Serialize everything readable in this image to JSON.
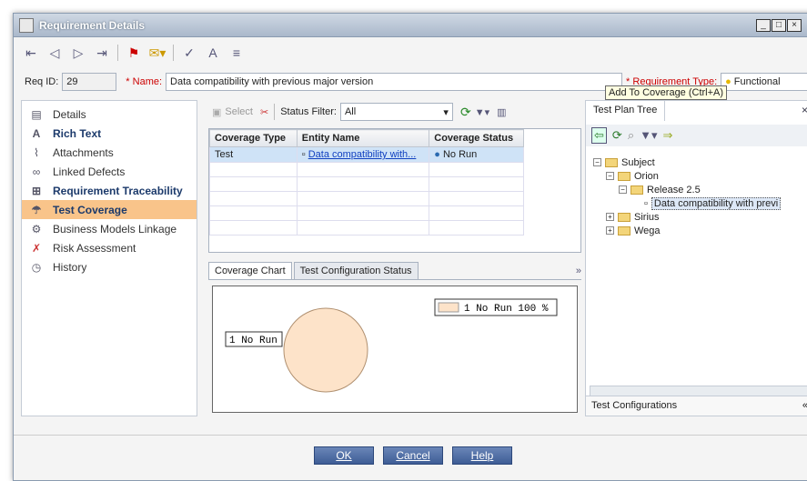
{
  "window": {
    "title": "Requirement Details"
  },
  "req": {
    "id_label": "Req ID:",
    "id_value": "29",
    "name_label": "* Name:",
    "name_value": "Data compatibility with previous major version",
    "type_label": "* Requirement Type:",
    "type_value": "Functional"
  },
  "nav": [
    {
      "label": "Details"
    },
    {
      "label": "Rich Text"
    },
    {
      "label": "Attachments"
    },
    {
      "label": "Linked Defects"
    },
    {
      "label": "Requirement Traceability"
    },
    {
      "label": "Test Coverage"
    },
    {
      "label": "Business Models Linkage"
    },
    {
      "label": "Risk Assessment"
    },
    {
      "label": "History"
    }
  ],
  "coverage": {
    "select_label": "Select",
    "status_filter_label": "Status Filter:",
    "status_filter_value": "All",
    "columns": [
      "Coverage Type",
      "Entity Name",
      "Coverage Status"
    ],
    "rows": [
      [
        "Test",
        "Data compatibility with...",
        "No Run"
      ]
    ]
  },
  "tabs2": [
    "Coverage Chart",
    "Test Configuration Status"
  ],
  "chart_data": {
    "type": "pie",
    "categories": [
      "No Run"
    ],
    "values": [
      100
    ],
    "slice_label": "1 No Run",
    "legend": [
      "1 No Run 100 %"
    ],
    "legend_position": "top-right",
    "colors": [
      "#fde3c9"
    ]
  },
  "test_plan": {
    "tab_label": "Test Plan Tree",
    "tooltip": "Add To Coverage (Ctrl+A)",
    "tree": [
      {
        "label": "Subject"
      },
      {
        "label": "Orion"
      },
      {
        "label": "Release 2.5"
      },
      {
        "label": "Data compatibility with previ"
      },
      {
        "label": "Sirius"
      },
      {
        "label": "Wega"
      }
    ],
    "footer": "Test Configurations"
  },
  "buttons": {
    "ok": "OK",
    "cancel": "Cancel",
    "help": "Help"
  }
}
